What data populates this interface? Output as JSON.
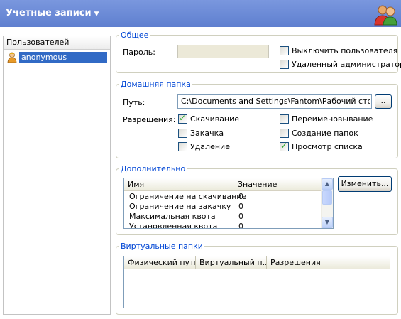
{
  "header": {
    "title": "Учетные записи",
    "users_icon": "users-icon"
  },
  "users_panel": {
    "title": "Пользователей",
    "items": [
      {
        "name": "anonymous",
        "icon": "user-icon",
        "selected": true
      }
    ]
  },
  "general": {
    "legend": "Общее",
    "password_label": "Пароль:",
    "password_value": "",
    "disable_user": {
      "label": "Выключить пользователя",
      "checked": false
    },
    "remote_admin": {
      "label": "Удаленный администратор",
      "checked": false
    }
  },
  "home": {
    "legend": "Домашняя папка",
    "path_label": "Путь:",
    "path_value": "C:\\Documents and Settings\\Fantom\\Рабочий стол\\WE",
    "browse_label": "..",
    "permissions_label": "Разрешения:",
    "permissions": {
      "download": {
        "label": "Скачивание",
        "checked": true
      },
      "upload": {
        "label": "Закачка",
        "checked": false
      },
      "delete": {
        "label": "Удаление",
        "checked": false
      },
      "rename": {
        "label": "Переименовывание",
        "checked": false
      },
      "mkdir": {
        "label": "Создание папок",
        "checked": false
      },
      "list": {
        "label": "Просмотр списка",
        "checked": true
      }
    }
  },
  "extra": {
    "legend": "Дополнительно",
    "columns": [
      "Имя",
      "Значение"
    ],
    "rows": [
      {
        "name": "Ограничение на скачивание",
        "value": "0"
      },
      {
        "name": "Ограничение на закачку",
        "value": "0"
      },
      {
        "name": "Максимальная квота",
        "value": "0"
      },
      {
        "name": "Установленная квота",
        "value": "0"
      }
    ],
    "edit_button": "Изменить..."
  },
  "virtual": {
    "legend": "Виртуальные папки",
    "columns": [
      "Физический путь",
      "Виртуальный п...",
      "Разрешения"
    ]
  },
  "colors": {
    "header_bg": "#6b8ad6",
    "legend_text": "#0046d5",
    "selection": "#316ac5",
    "check_mark": "#21a121"
  }
}
